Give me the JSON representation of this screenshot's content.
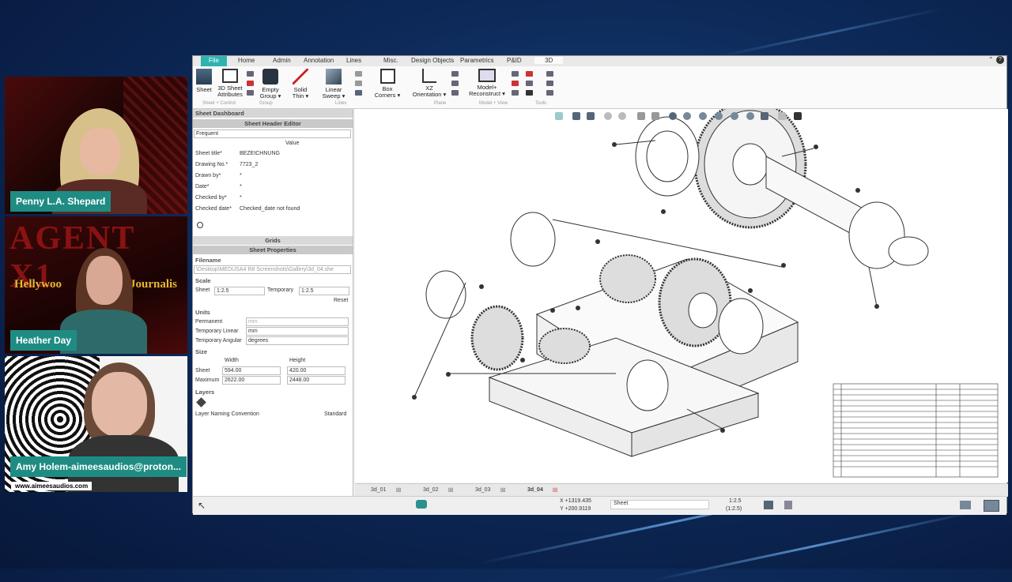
{
  "participants": [
    {
      "name": "Penny L.A. Shepard"
    },
    {
      "name": "Heather Day"
    },
    {
      "name": "Amy Holem-aimeesaudios@proton...",
      "site": "www.aimeesaudios.com"
    }
  ],
  "overlay_texts": {
    "banner_word": "AGENT X1",
    "banner_sub": "Hellywoo",
    "banner_sub2": "Journalis"
  },
  "app": {
    "menu": {
      "file": "File",
      "items": [
        "Home",
        "Admin",
        "Annotation",
        "Lines",
        "Misc.",
        "Design Objects",
        "Parametrics",
        "P&ID",
        "3D"
      ]
    },
    "ribbon": [
      {
        "label1": "Sheet",
        "label2": ""
      },
      {
        "label1": "3D Sheet",
        "label2": "Attributes"
      },
      {
        "label1": "Empty",
        "label2": "Group ▾"
      },
      {
        "label1": "Solid",
        "label2": "Thin ▾"
      },
      {
        "label1": "Linear",
        "label2": "Sweep ▾"
      },
      {
        "label1": "Box",
        "label2": "Corners ▾"
      },
      {
        "label1": "XZ",
        "label2": "Orientation ▾"
      },
      {
        "label1": "Model+",
        "label2": "Reconstruct ▾"
      }
    ],
    "panel": {
      "dashboard": "Sheet Dashboard",
      "header_editor": "Sheet Header Editor",
      "frequent": "Frequent",
      "value_col": "Value",
      "fields": [
        {
          "label": "Sheet title*",
          "value": "BEZEICHNUNG"
        },
        {
          "label": "Drawing No.*",
          "value": "7723_2"
        },
        {
          "label": "Drawn by*",
          "value": "*"
        },
        {
          "label": "Date*",
          "value": "*"
        },
        {
          "label": "Checked by*",
          "value": "*"
        },
        {
          "label": "Checked date*",
          "value": "Checked_date not found"
        }
      ],
      "grids": "Grids",
      "sheet_props": "Sheet Properties",
      "filename_label": "Filename",
      "filename": "\\Desktop\\MEDUSA4 R8 Screenshots\\Gallery\\3d_04.she",
      "scale_label": "Scale",
      "sheet_label": "Sheet",
      "sheet_scale": "1:2.5",
      "temporary_label": "Temporary",
      "temporary_scale": "1:2.5",
      "reset": "Reset",
      "units_label": "Units",
      "permanent_label": "Permanent",
      "permanent_value": "mm",
      "temp_linear_label": "Temporary Linear",
      "temp_linear_value": "mm",
      "temp_angular_label": "Temporary Angular",
      "temp_angular_value": "degrees",
      "size_label": "Size",
      "width_label": "Width",
      "height_label": "Height",
      "size_sheet_label": "Sheet",
      "sheet_width": "594.00",
      "sheet_height": "420.00",
      "maximum_label": "Maximum",
      "max_width": "2622.00",
      "max_height": "2448.00",
      "layers_label": "Layers",
      "layer_naming": "Layer Naming Convention",
      "layer_standard": "Standard"
    },
    "sheet_tabs": [
      "3d_01",
      "3d_02",
      "3d_03",
      "3d_04"
    ],
    "status": {
      "x": "X +1319.435",
      "y": "Y +200.9119",
      "mode": "Sheet",
      "scale": "1:2.5",
      "scale2": "(1:2.5)"
    }
  },
  "colors": {
    "name_tag": "#1f8c84",
    "file_tab": "#2fb3b0"
  }
}
